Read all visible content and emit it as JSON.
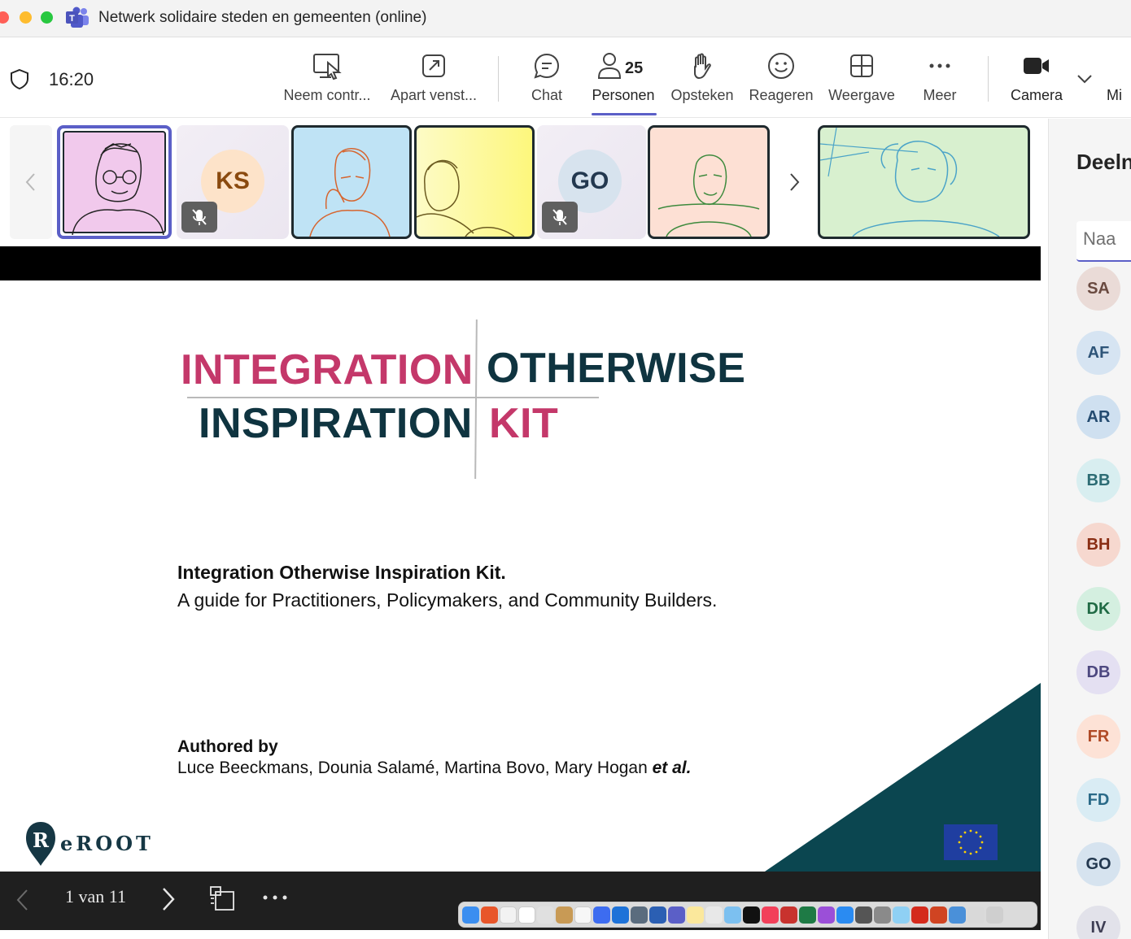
{
  "window": {
    "title": "Netwerk solidaire steden en gemeenten (online)"
  },
  "toolbar": {
    "time": "16:20",
    "buttons": [
      {
        "label": "Neem contr...",
        "icon": "take-control-icon"
      },
      {
        "label": "Apart venst...",
        "icon": "pop-out-icon"
      },
      {
        "label": "Chat",
        "icon": "chat-icon"
      },
      {
        "label": "Personen",
        "icon": "people-icon",
        "badge": "25",
        "active": true
      },
      {
        "label": "Opsteken",
        "icon": "raise-hand-icon"
      },
      {
        "label": "Reageren",
        "icon": "react-icon"
      },
      {
        "label": "Weergave",
        "icon": "view-grid-icon"
      },
      {
        "label": "Meer",
        "icon": "more-icon"
      },
      {
        "label": "Camera",
        "icon": "camera-icon"
      },
      {
        "label": "Mi",
        "icon": "microphone-icon"
      }
    ],
    "accent": "#5b5fc7"
  },
  "participants_strip": {
    "tiles": [
      {
        "kind": "video",
        "bg": "#f1c9ec",
        "selected": true
      },
      {
        "kind": "avatar",
        "initials": "KS",
        "muted": true,
        "avatar_bg": "#fde3c9",
        "avatar_fg": "#8a4a0f"
      },
      {
        "kind": "video",
        "bg": "#bfe3f5"
      },
      {
        "kind": "video",
        "bg": "#fdfaa8"
      },
      {
        "kind": "avatar",
        "initials": "GO",
        "muted": true,
        "avatar_bg": "#d7e3ee",
        "avatar_fg": "#23384f"
      },
      {
        "kind": "video",
        "bg": "#fde0d4"
      },
      {
        "kind": "video",
        "bg": "#d8f0cf"
      }
    ]
  },
  "slide": {
    "title_left_1": "INTEGRATION",
    "title_right_1": "OTHERWISE",
    "title_left_2": "INSPIRATION",
    "title_right_2": "KIT",
    "subtitle_bold": "Integration Otherwise Inspiration Kit.",
    "subtitle": "A guide for Practitioners, Policymakers, and Community Builders.",
    "authored_label": "Authored by",
    "authors": "Luce Beeckmans, Dounia Salamé, Martina Bovo, Mary Hogan ",
    "authors_suffix": "et al.",
    "logo_text": "eROOT",
    "logo_letter": "R",
    "colors": {
      "pink": "#c4386a",
      "dark_teal": "#0f3440",
      "triangle": "#0b4650",
      "eu_blue": "#1f3ea0"
    }
  },
  "presentation_controls": {
    "page_indicator": "1 van 11"
  },
  "people_panel": {
    "title": "Deeln",
    "search_placeholder": "Naa",
    "people": [
      {
        "initials": "SA",
        "bg": "#eadbd7",
        "fg": "#6a4a40"
      },
      {
        "initials": "AF",
        "bg": "#d6e4f2",
        "fg": "#2e5478"
      },
      {
        "initials": "AR",
        "bg": "#cfe0f0",
        "fg": "#244b70"
      },
      {
        "initials": "BB",
        "bg": "#d8eef0",
        "fg": "#2d6c74"
      },
      {
        "initials": "BH",
        "bg": "#f6d8cf",
        "fg": "#8a2e14"
      },
      {
        "initials": "DK",
        "bg": "#d4efe0",
        "fg": "#1f6a44"
      },
      {
        "initials": "DB",
        "bg": "#e4e0f2",
        "fg": "#4d4880"
      },
      {
        "initials": "FR",
        "bg": "#fde2d6",
        "fg": "#b04a26"
      },
      {
        "initials": "FD",
        "bg": "#d9ecf4",
        "fg": "#2a6a88"
      },
      {
        "initials": "GO",
        "bg": "#d6e3ef",
        "fg": "#23384f"
      },
      {
        "initials": "IV",
        "bg": "#e2e2ea",
        "fg": "#3e3e54"
      }
    ]
  }
}
